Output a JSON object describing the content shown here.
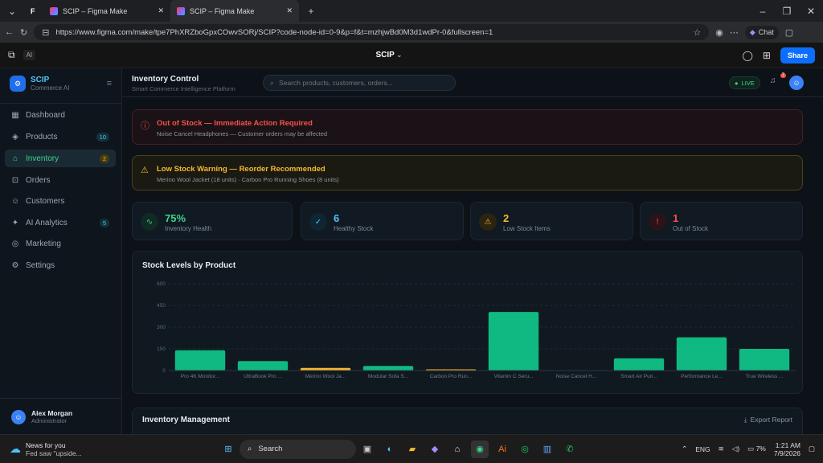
{
  "browser": {
    "tabs": [
      {
        "title": "SCIP – Figma Make"
      },
      {
        "title": "SCIP – Figma Make"
      }
    ],
    "url": "https://www.figma.com/make/tpe7PhXRZboGpxCOwvSORj/SCIP?code-node-id=0-9&p=f&t=mzhjwBd0M3d1wdPr-0&fullscreen=1",
    "chat_label": "Chat"
  },
  "figma": {
    "ai_label": "AI",
    "project_name": "SCIP",
    "share_label": "Share"
  },
  "app": {
    "brand_name": "SCIP",
    "brand_sub": "Commerce AI",
    "nav": [
      {
        "label": "Dashboard",
        "badge": "",
        "icon": "grid-icon"
      },
      {
        "label": "Products",
        "badge": "10",
        "icon": "box-icon"
      },
      {
        "label": "Inventory",
        "badge": "2",
        "icon": "warehouse-icon"
      },
      {
        "label": "Orders",
        "badge": "",
        "icon": "cart-icon"
      },
      {
        "label": "Customers",
        "badge": "",
        "icon": "users-icon"
      },
      {
        "label": "AI Analytics",
        "badge": "5",
        "icon": "spark-icon"
      },
      {
        "label": "Marketing",
        "badge": "",
        "icon": "target-icon"
      },
      {
        "label": "Settings",
        "badge": "",
        "icon": "gear-icon"
      }
    ],
    "user": {
      "name": "Alex Morgan",
      "role": "Administrator"
    },
    "header": {
      "title": "Inventory Control",
      "subtitle": "Smart Commerce Intelligence Platform",
      "search_placeholder": "Search products, customers, orders...",
      "live_label": "LIVE",
      "notif_count": "7"
    },
    "alerts": {
      "out_of_stock_title": "Out of Stock — Immediate Action Required",
      "out_of_stock_detail": "Noise Cancel Headphones — Customer orders may be affected",
      "low_stock_title": "Low Stock Warning — Reorder Recommended",
      "low_stock_detail": "Merino Wool Jacket (18 units) · Carbon Pro Running Shoes (8 units)"
    },
    "stats": [
      {
        "value": "75%",
        "label": "Inventory Health",
        "color": "#3dd68c"
      },
      {
        "value": "6",
        "label": "Healthy Stock",
        "color": "#4fc3f7"
      },
      {
        "value": "2",
        "label": "Low Stock Items",
        "color": "#f5b92e"
      },
      {
        "value": "1",
        "label": "Out of Stock",
        "color": "#f85149"
      }
    ],
    "section_inventory_mgmt": "Inventory Management",
    "export_label": "Export Report"
  },
  "chart_data": {
    "type": "bar",
    "title": "Stock Levels by Product",
    "categories": [
      "Pro 4K Monitor...",
      "UltraBook Pro ...",
      "Merino Wool Ja...",
      "Modular Sofa S...",
      "Carbon Pro Run...",
      "Vitamin C Seru...",
      "Noise Cancel H...",
      "Smart Air Puri...",
      "Performance Le...",
      "True Wireless ..."
    ],
    "values": [
      140,
      65,
      18,
      32,
      8,
      405,
      0,
      85,
      230,
      150
    ],
    "colors": [
      "#10b981",
      "#10b981",
      "#f5b92e",
      "#10b981",
      "#f5b92e",
      "#10b981",
      "#10b981",
      "#10b981",
      "#10b981",
      "#10b981"
    ],
    "yticks": [
      "600",
      "450",
      "300",
      "150",
      "0"
    ],
    "ylim": [
      0,
      600
    ],
    "grid": true
  },
  "taskbar": {
    "news_title": "News for you",
    "news_detail": "Fed saw \"upside...",
    "search_label": "Search",
    "lang": "ENG",
    "battery": "7%",
    "time": "1:21 AM",
    "date": "7/9/2026"
  }
}
